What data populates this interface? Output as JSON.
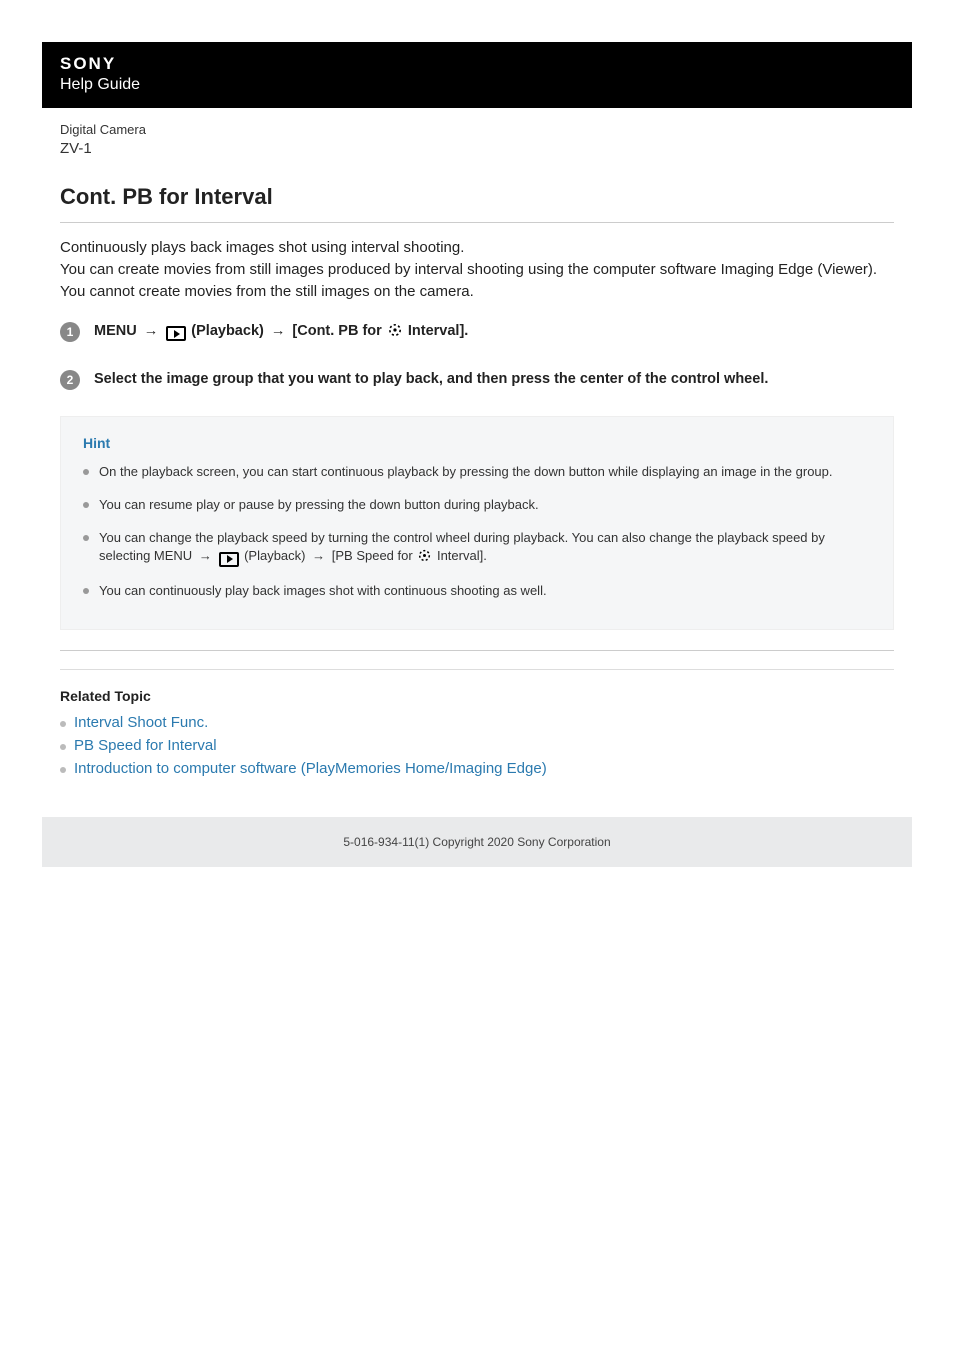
{
  "header": {
    "brand": "SONY",
    "subtitle": "Help Guide"
  },
  "product": {
    "category": "Digital Camera",
    "model": "ZV-1"
  },
  "title": "Cont. PB for Interval",
  "intro": {
    "p1": "Continuously plays back images shot using interval shooting.",
    "p2": "You can create movies from still images produced by interval shooting using the computer software Imaging Edge (Viewer). You cannot create movies from the still images on the camera."
  },
  "steps": {
    "s1": {
      "num": "1",
      "t1": "MENU",
      "t2": "(Playback)",
      "t3": "[Cont. PB for",
      "t4": "Interval]."
    },
    "s2": {
      "num": "2",
      "text": "Select the image group that you want to play back, and then press the center of the control wheel."
    }
  },
  "hint": {
    "title": "Hint",
    "items": {
      "h1": "On the playback screen, you can start continuous playback by pressing the down button while displaying an image in the group.",
      "h2": "You can resume play or pause by pressing the down button during playback.",
      "h3a": "You can change the playback speed by turning the control wheel during playback. You can also change the playback speed by selecting MENU",
      "h3b": "(Playback)",
      "h3c": "[PB Speed for",
      "h3d": "Interval].",
      "h4": "You can continuously play back images shot with continuous shooting as well."
    }
  },
  "related": {
    "title": "Related Topic",
    "links": {
      "r1": "Interval Shoot Func.",
      "r2": "PB Speed for Interval",
      "r3": "Introduction to computer software (PlayMemories Home/Imaging Edge)"
    }
  },
  "footer": "5-016-934-11(1) Copyright 2020 Sony Corporation",
  "arrow": "→"
}
